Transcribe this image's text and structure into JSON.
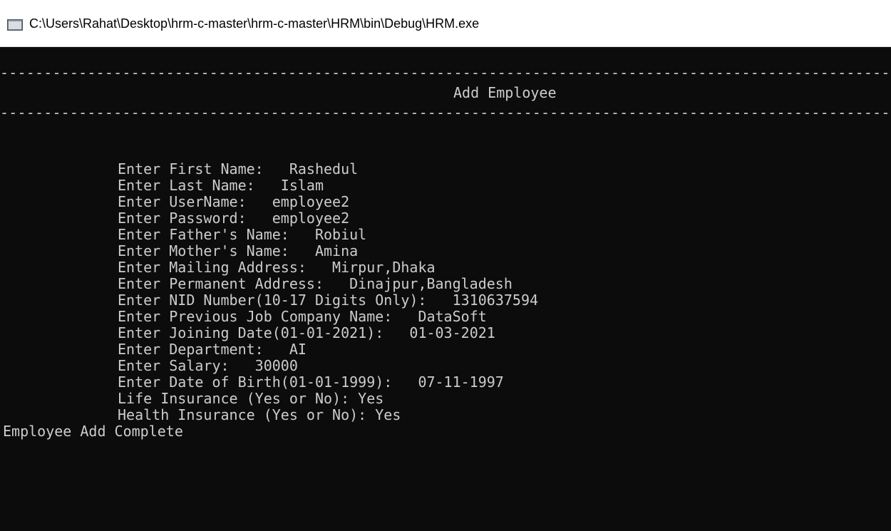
{
  "window": {
    "title": "C:\\Users\\Rahat\\Desktop\\hrm-c-master\\hrm-c-master\\HRM\\bin\\Debug\\HRM.exe",
    "icon": "console-window-icon"
  },
  "console": {
    "separator": "--------------------------------------------------------------------------------------------------------------------------",
    "heading": "Add Employee",
    "fields": [
      {
        "label": "Enter First Name:   ",
        "value": "Rashedul"
      },
      {
        "label": "Enter Last Name:   ",
        "value": "Islam"
      },
      {
        "label": "Enter UserName:   ",
        "value": "employee2"
      },
      {
        "label": "Enter Password:   ",
        "value": "employee2"
      },
      {
        "label": "Enter Father's Name:   ",
        "value": "Robiul"
      },
      {
        "label": "Enter Mother's Name:   ",
        "value": "Amina"
      },
      {
        "label": "Enter Mailing Address:   ",
        "value": "Mirpur,Dhaka"
      },
      {
        "label": "Enter Permanent Address:   ",
        "value": "Dinajpur,Bangladesh"
      },
      {
        "label": "Enter NID Number(10-17 Digits Only):   ",
        "value": "1310637594"
      },
      {
        "label": "Enter Previous Job Company Name:   ",
        "value": "DataSoft"
      },
      {
        "label": "Enter Joining Date(01-01-2021):   ",
        "value": "01-03-2021"
      },
      {
        "label": "Enter Department:   ",
        "value": "AI"
      },
      {
        "label": "Enter Salary:   ",
        "value": "30000"
      },
      {
        "label": "Enter Date of Birth(01-01-1999):   ",
        "value": "07-11-1997"
      },
      {
        "label": "Life Insurance (Yes or No): ",
        "value": "Yes"
      },
      {
        "label": "Health Insurance (Yes or No): ",
        "value": "Yes"
      }
    ],
    "status": "Employee Add Complete"
  },
  "colors": {
    "console_background": "#0c0c0c",
    "console_text": "#cccccc",
    "titlebar_background": "#ffffff"
  }
}
